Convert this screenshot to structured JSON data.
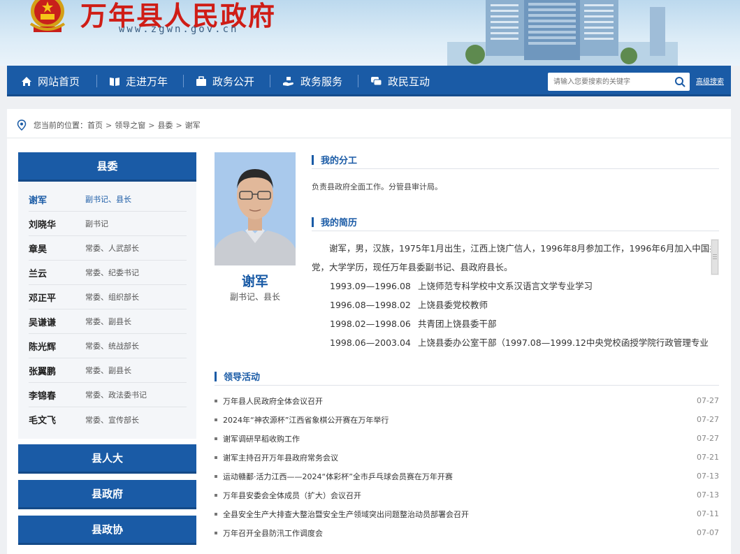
{
  "header": {
    "site_title": "万年县人民政府",
    "site_url": "www.zgwn.gov.cn"
  },
  "nav": {
    "items": [
      {
        "label": "网站首页",
        "icon": "home-icon"
      },
      {
        "label": "走进万年",
        "icon": "book-icon"
      },
      {
        "label": "政务公开",
        "icon": "briefcase-icon"
      },
      {
        "label": "政务服务",
        "icon": "service-hand-icon"
      },
      {
        "label": "政民互动",
        "icon": "chat-icon"
      }
    ],
    "search_placeholder": "请输入您要搜索的关键字",
    "advanced_search": "高级搜索"
  },
  "breadcrumb": {
    "prefix": "您当前的位置：",
    "items": [
      "首页",
      "领导之窗",
      "县委",
      "谢军"
    ],
    "separator": ">"
  },
  "sidebar": {
    "section_title": "县委",
    "leaders": [
      {
        "name": "谢军",
        "title": "副书记、县长"
      },
      {
        "name": "刘晓华",
        "title": "副书记"
      },
      {
        "name": "章昊",
        "title": "常委、人武部长"
      },
      {
        "name": "兰云",
        "title": "常委、纪委书记"
      },
      {
        "name": "邓正平",
        "title": "常委、组织部长"
      },
      {
        "name": "吴谦谦",
        "title": "常委、副县长"
      },
      {
        "name": "陈光辉",
        "title": "常委、统战部长"
      },
      {
        "name": "张翼鹏",
        "title": "常委、副县长"
      },
      {
        "name": "李锦春",
        "title": "常委、政法委书记"
      },
      {
        "name": "毛文飞",
        "title": "常委、宣传部长"
      }
    ],
    "other_sections": [
      "县人大",
      "县政府",
      "县政协"
    ]
  },
  "profile": {
    "name": "谢军",
    "position": "副书记、县长",
    "duty_heading": "我的分工",
    "duty_text": "负责县政府全面工作。分管县审计局。",
    "resume_heading": "我的简历",
    "resume_intro": "谢军，男，汉族，1975年1月出生，江西上饶广信人，1996年8月参加工作，1996年6月加入中国共产党，大学学历，现任万年县委副书记、县政府县长。",
    "resume_items": [
      {
        "period": "1993.09—1996.08",
        "desc": "上饶师范专科学校中文系汉语言文学专业学习"
      },
      {
        "period": "1996.08—1998.02",
        "desc": "上饶县委党校教师"
      },
      {
        "period": "1998.02—1998.06",
        "desc": "共青团上饶县委干部"
      },
      {
        "period": "1998.06—2003.04",
        "desc": "上饶县委办公室干部（1997.08—1999.12中央党校函授学院行政管理专业本科班学习）"
      }
    ]
  },
  "activities": {
    "heading": "领导活动",
    "items": [
      {
        "title": "万年县人民政府全体会议召开",
        "date": "07-27"
      },
      {
        "title": "2024年“神农源杯”江西省象棋公开赛在万年举行",
        "date": "07-27"
      },
      {
        "title": "谢军调研早稻收购工作",
        "date": "07-27"
      },
      {
        "title": "谢军主持召开万年县政府常务会议",
        "date": "07-21"
      },
      {
        "title": "运动赣鄱·活力江西——2024“体彩杯”全市乒乓球会员赛在万年开赛",
        "date": "07-13"
      },
      {
        "title": "万年县安委会全体成员（扩大）会议召开",
        "date": "07-13"
      },
      {
        "title": "全县安全生产大排查大整治暨安全生产领域突出问题整治动员部署会召开",
        "date": "07-11"
      },
      {
        "title": "万年召开全县防汛工作调度会",
        "date": "07-07"
      }
    ]
  },
  "colors": {
    "brand_blue": "#1a5ba6",
    "title_red": "#cf1d16"
  }
}
